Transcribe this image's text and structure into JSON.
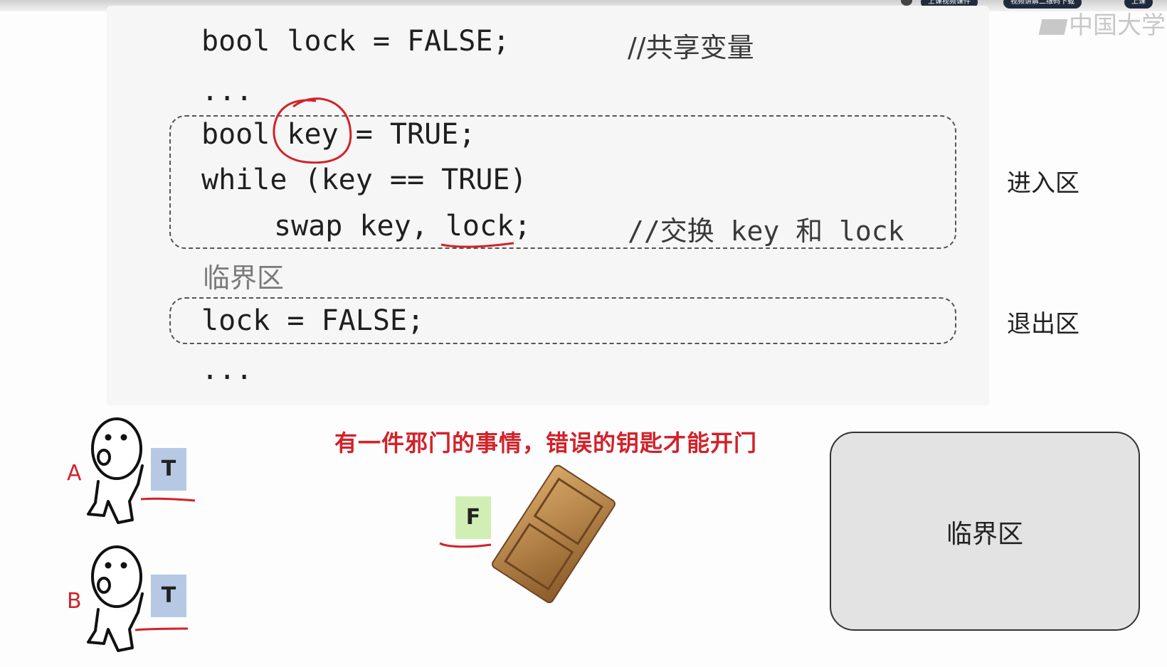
{
  "code": {
    "line1": "bool lock = FALSE;",
    "line1_comment": "//共享变量",
    "ellipsis_top": "...",
    "line2": "bool key = TRUE;",
    "line3": "while (key == TRUE)",
    "line4": "swap key, lock;",
    "line4_comment": "//交换 key 和 lock",
    "critical_text": "临界区",
    "line5": "lock = FALSE;",
    "ellipsis_bottom": "..."
  },
  "labels": {
    "entry": "进入区",
    "exit": "退出区"
  },
  "watermark": "中国大学",
  "topbar": {
    "pills": [
      "上课视频课件",
      "视频讲解二维码下载",
      "上课"
    ]
  },
  "scene": {
    "message": "有一件邪门的事情，错误的钥匙才能开门",
    "person_a": "A",
    "person_b": "B",
    "token_a": "T",
    "token_b": "T",
    "door_token": "F",
    "critical_box": "临界区"
  },
  "colors": {
    "annotation_red": "#d2222a",
    "token_true": "#b6c8e4",
    "token_false": "#d1efb5",
    "door": "#b07a3c"
  }
}
